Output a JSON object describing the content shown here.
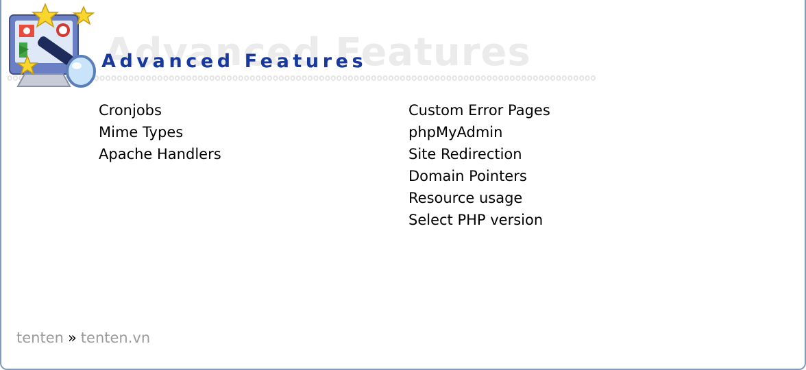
{
  "section": {
    "title": "Advanced Features",
    "watermark": "Advanced Features",
    "icon": "computer-stars-icon"
  },
  "features": {
    "left": [
      {
        "label": "Cronjobs"
      },
      {
        "label": "Mime Types"
      },
      {
        "label": "Apache Handlers"
      }
    ],
    "right": [
      {
        "label": "Custom Error Pages"
      },
      {
        "label": "phpMyAdmin"
      },
      {
        "label": "Site Redirection"
      },
      {
        "label": "Domain Pointers"
      },
      {
        "label": "Resource usage"
      },
      {
        "label": "Select PHP version"
      }
    ]
  },
  "breadcrumb": {
    "items": [
      "tenten",
      "tenten.vn"
    ],
    "separator": "»"
  },
  "colors": {
    "title": "#16389f",
    "breadcrumb_link": "#9b9b9b",
    "border": "#7f9db9"
  }
}
